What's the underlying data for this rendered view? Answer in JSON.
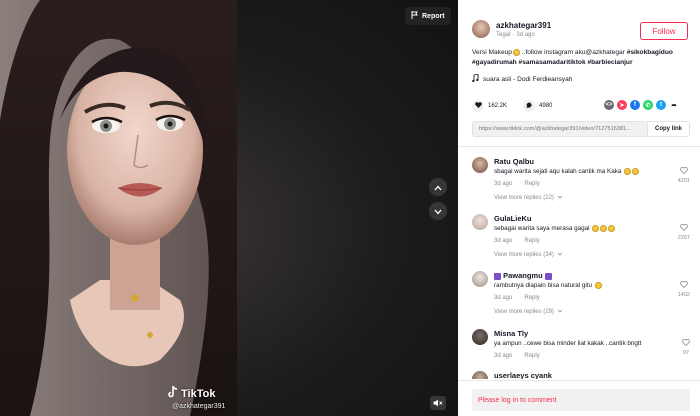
{
  "video": {
    "report_label": "Report",
    "watermark_brand": "TikTok",
    "watermark_user": "@azkhategar391"
  },
  "author": {
    "username": "azkhategar391",
    "display_name": "Tegar",
    "posted": "3d ago",
    "follow_label": "Follow"
  },
  "description": {
    "text_start": "Versi Makeup",
    "text_mid": " ..follow instagram aku@azkhategar ",
    "hashtags": "#sikokbagiduo #gayadirumah #samasamadaritiktok #barbiecianjur",
    "music": "suara asli - Dodi Ferdieansyah"
  },
  "stats": {
    "likes": "162.2K",
    "comments": "4980"
  },
  "share": {
    "link": "https://www.tiktok.com/@azkhategar391/video/7127516381...",
    "copy_label": "Copy link",
    "colors": [
      "#ff3b5c",
      "#1877f2",
      "#25d366",
      "#1da1f2",
      "#7a2cc6"
    ]
  },
  "comments": [
    {
      "name": "Ratu Qalbu",
      "text": "sbagai warita sejati aqu kalah cantik ma Kaka",
      "emojis": 2,
      "time": "3d ago",
      "reply": "Reply",
      "likes": "4201",
      "replies": "View more replies (22)"
    },
    {
      "name": "GulaLieKu",
      "text": "sebagai warita saya merasa gagal",
      "emojis": 3,
      "time": "3d ago",
      "reply": "Reply",
      "likes": "2267",
      "replies": "View more replies (34)"
    },
    {
      "name": "Pawangmu",
      "text": "rambutnya diapain bisa natural gitu",
      "emojis": 1,
      "time": "3d ago",
      "reply": "Reply",
      "likes": "1402",
      "replies": "View more replies (29)"
    },
    {
      "name": "Misna Tly",
      "text": "ya ampun ..cewe bisa minder liat kakak ..cantik bngtt",
      "emojis": 0,
      "time": "3d ago",
      "reply": "Reply",
      "likes": "97",
      "replies": ""
    },
    {
      "name": "userlaeys cyank",
      "text": "",
      "emojis": 0,
      "time": "",
      "reply": "",
      "likes": "",
      "replies": ""
    }
  ],
  "login_prompt": "Please log in to comment"
}
